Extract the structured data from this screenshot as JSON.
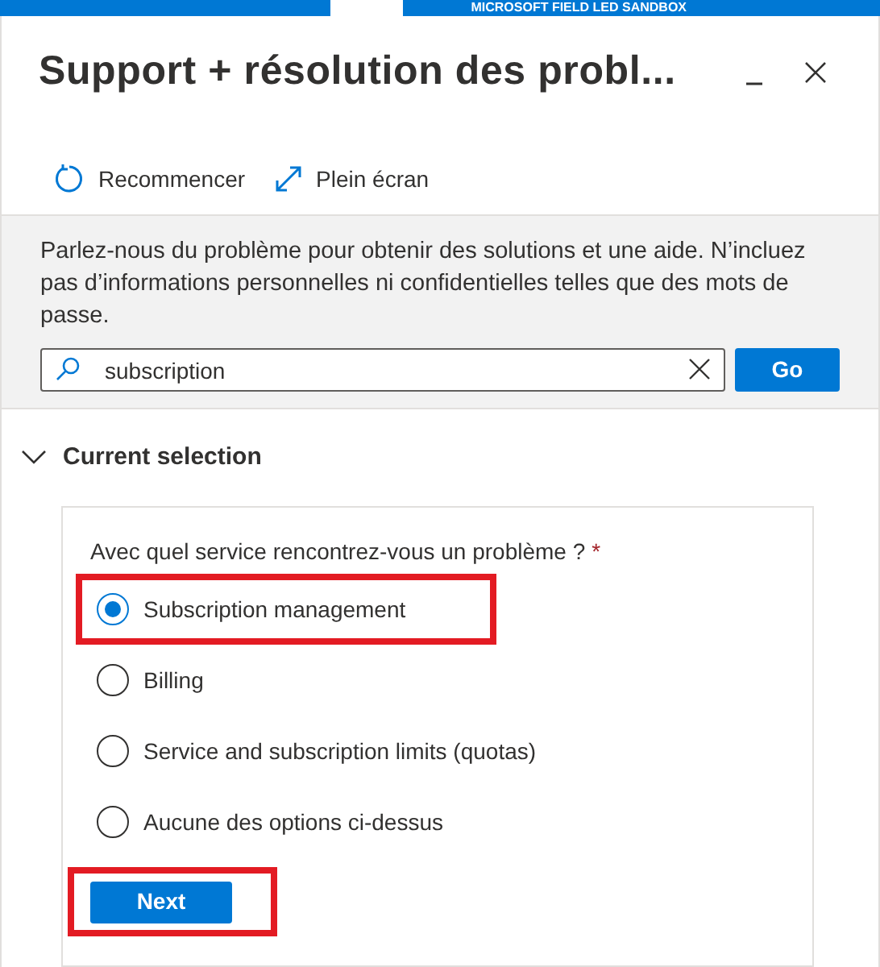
{
  "top_bar": {
    "label": "MICROSOFT FIELD LED SANDBOX"
  },
  "panel": {
    "title": "Support + résolution des probl..."
  },
  "toolbar": [
    {
      "kind": "restart",
      "label": "Recommencer"
    },
    {
      "kind": "fullscreen",
      "label": "Plein écran"
    }
  ],
  "intro": {
    "text": "Parlez-nous du problème pour obtenir des solutions et une aide. N’incluez pas d’informations personnelles ni confidentielles telles que des mots de passe.",
    "search_value": "subscription",
    "go_button": "Go"
  },
  "section": {
    "title": "Current selection",
    "expanded": true,
    "question": "Avec quel service rencontrez-vous un problème ?",
    "required_mark": "*",
    "options": [
      {
        "label": "Subscription management",
        "selected": true,
        "highlighted": true
      },
      {
        "label": "Billing",
        "selected": false,
        "highlighted": false
      },
      {
        "label": "Service and subscription limits (quotas)",
        "selected": false,
        "highlighted": false
      },
      {
        "label": "Aucune des options ci-dessus",
        "selected": false,
        "highlighted": false
      }
    ],
    "next_button": {
      "label": "Next",
      "highlighted": true
    }
  }
}
